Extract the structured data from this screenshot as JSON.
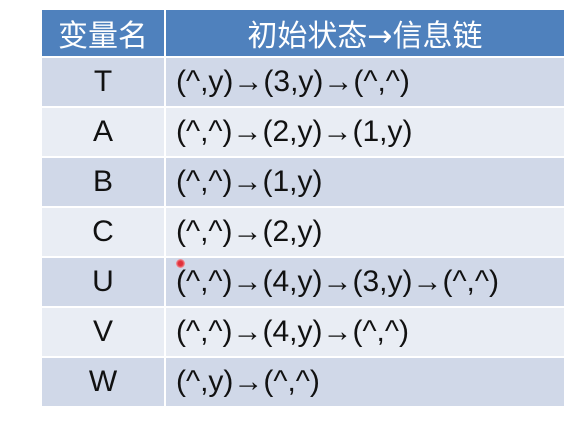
{
  "table": {
    "headers": {
      "name": "变量名",
      "chain": "初始状态→信息链"
    },
    "rows": [
      {
        "name": "T",
        "chain": "(^,y)→(3,y)→(^,^)"
      },
      {
        "name": "A",
        "chain": "(^,^)→(2,y)→(1,y)"
      },
      {
        "name": "B",
        "chain": "(^,^)→(1,y)"
      },
      {
        "name": "C",
        "chain": "(^,^)→(2,y)"
      },
      {
        "name": "U",
        "chain": "(^,^)→(4,y)→(3,y)→(^,^)"
      },
      {
        "name": "V",
        "chain": "(^,^)→(4,y)→(^,^)"
      },
      {
        "name": "W",
        "chain": "(^,y)→(^,^)"
      }
    ]
  },
  "colors": {
    "header_bg": "#4f81bd",
    "row_odd_bg": "#d0d8e8",
    "row_even_bg": "#e9edf4",
    "pointer": "#e0303a"
  }
}
